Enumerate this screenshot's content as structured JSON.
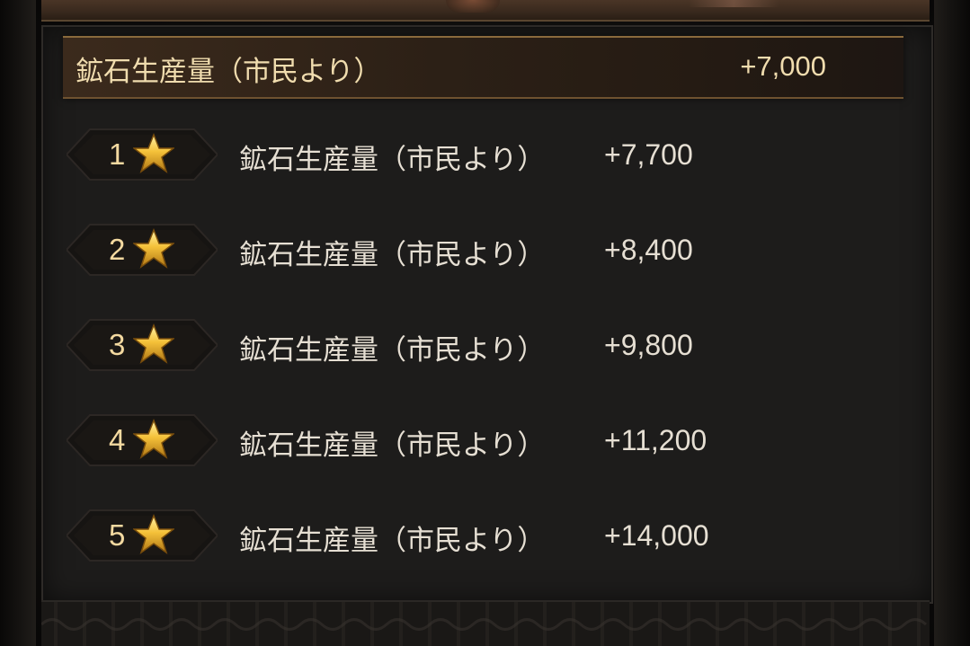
{
  "header": {
    "label": "鉱石生産量（市民より）",
    "value": "+7,000"
  },
  "ranks": [
    {
      "number": "1",
      "label": "鉱石生産量（市民より）",
      "amount": "+7,700"
    },
    {
      "number": "2",
      "label": "鉱石生産量（市民より）",
      "amount": "+8,400"
    },
    {
      "number": "3",
      "label": "鉱石生産量（市民より）",
      "amount": "+9,800"
    },
    {
      "number": "4",
      "label": "鉱石生産量（市民より）",
      "amount": "+11,200"
    },
    {
      "number": "5",
      "label": "鉱石生産量（市民より）",
      "amount": "+14,000"
    }
  ],
  "icons": {
    "star": "star-icon",
    "badge": "rank-badge"
  },
  "colors": {
    "header_text": "#f0dcae",
    "row_text": "#e6dfd3",
    "star_gold": "#f5c23a",
    "panel_bg": "#1d1c1b"
  }
}
